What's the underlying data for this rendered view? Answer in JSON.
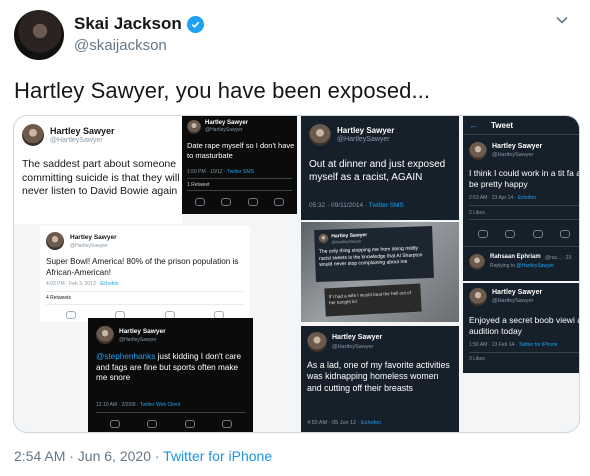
{
  "author": {
    "name": "Skai Jackson",
    "handle": "@skaijackson"
  },
  "tweet": {
    "text": "Hartley Sawyer, you have been exposed...",
    "time": "2:54 AM · Jun 6, 2020 · ",
    "source": "Twitter for iPhone"
  },
  "icons": {
    "verified": "verified-badge-icon",
    "menu": "chevron-down-icon"
  },
  "colors": {
    "accent": "#1da1f2",
    "dark_card": "#15202b"
  },
  "screenshots": {
    "c1": {
      "name": "Hartley Sawyer",
      "handle": "@HartleySawyer",
      "text": "The saddest part about someone committing suicide is that they will never listen to David Bowie again"
    },
    "c2": {
      "name": "Hartley Sawyer",
      "handle": "@HartleySawyer",
      "text": "Date rape myself so I don't have to masturbate",
      "meta": "1:50 PM · 10/12 · ",
      "source": "Twitter SMS",
      "stat": "1 Retweet"
    },
    "c3": {
      "name": "Hartley Sawyer",
      "handle": "@HartleySawyer",
      "text": "Out at dinner and just exposed myself as a racist, AGAIN",
      "meta": "05:32 · 09/11/2014 · ",
      "source": "Twitter SMS"
    },
    "c4": {
      "back": "←",
      "title": "Tweet",
      "name": "Hartley Sawyer",
      "handle": "@HartleySawyer",
      "text": "I think I could work in a tit fa and be pretty happy",
      "meta": "2:53 AM · 23 Apr 14 · ",
      "source": "Echofon",
      "stat": "2 Likes",
      "reply_name": "Rahsaan Ephriam",
      "reply_handle": "@ras... · 23",
      "reply_to": "Replying to ",
      "reply_mention": "@HartleySawyer"
    },
    "c5": {
      "name": "Hartley Sawyer",
      "handle": "@HartleySawyer",
      "text": "Super Bowl! America! 80% of the prison population is African-American!",
      "meta": "4:03 PM · Feb 3, 2013 · ",
      "source": "Echofon",
      "stat": "4 Retweets"
    },
    "c6": {
      "name": "Hartley Sawyer",
      "handle": "@HartleySawyer",
      "text": "The only thing stopping me from doing mildly racist tweets is the knowledge that Al Sharpton would never stop complaining about me",
      "text2": "If I had a wife I would beat the hell out of her tonight lol"
    },
    "c7": {
      "name": "Hartley Sawyer",
      "handle": "@HartleySawyer",
      "text": "Enjoyed a secret boob viewi an audition today",
      "meta": "1:56 AM · 13 Feb 14 · ",
      "source": "Twitter for iPhone",
      "stat": "3 Likes"
    },
    "c8": {
      "name": "Hartley Sawyer",
      "handle": "@HartleySawyer",
      "mention": "@stephenhanks",
      "text": " just kidding I don't care and fags are fine but sports often make me snore",
      "meta": "12:10 AM · 2/2/09 · ",
      "source": "Twitter Web Client"
    },
    "c9": {
      "name": "Hartley Sawyer",
      "handle": "@HartleySawyer",
      "text": "As a lad, one of my favorite activities was kidnapping homeless women and cutting off their breasts",
      "meta": "4:50 AM · 05 Jun 12 · ",
      "source": "Echofon"
    }
  }
}
